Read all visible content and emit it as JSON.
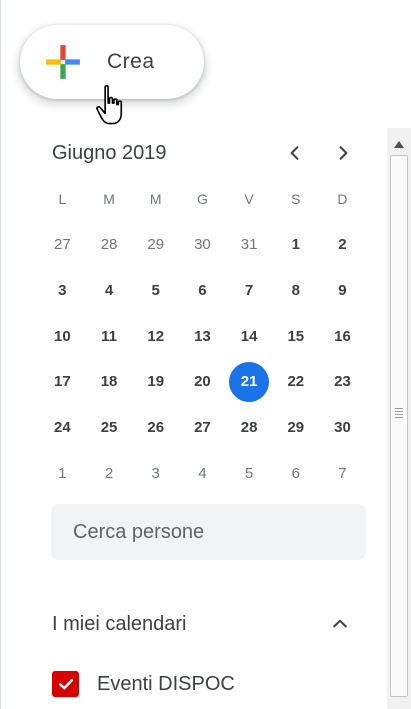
{
  "create_button": {
    "label": "Crea"
  },
  "mini_calendar": {
    "month_title": "Giugno 2019",
    "weekdays": [
      "L",
      "M",
      "M",
      "G",
      "V",
      "S",
      "D"
    ],
    "weeks": [
      [
        {
          "d": "27",
          "out": true
        },
        {
          "d": "28",
          "out": true
        },
        {
          "d": "29",
          "out": true
        },
        {
          "d": "30",
          "out": true
        },
        {
          "d": "31",
          "out": true
        },
        {
          "d": "1"
        },
        {
          "d": "2"
        }
      ],
      [
        {
          "d": "3"
        },
        {
          "d": "4"
        },
        {
          "d": "5"
        },
        {
          "d": "6"
        },
        {
          "d": "7"
        },
        {
          "d": "8"
        },
        {
          "d": "9"
        }
      ],
      [
        {
          "d": "10"
        },
        {
          "d": "11"
        },
        {
          "d": "12"
        },
        {
          "d": "13"
        },
        {
          "d": "14"
        },
        {
          "d": "15"
        },
        {
          "d": "16"
        }
      ],
      [
        {
          "d": "17"
        },
        {
          "d": "18"
        },
        {
          "d": "19"
        },
        {
          "d": "20"
        },
        {
          "d": "21",
          "today": true
        },
        {
          "d": "22"
        },
        {
          "d": "23"
        }
      ],
      [
        {
          "d": "24"
        },
        {
          "d": "25"
        },
        {
          "d": "26"
        },
        {
          "d": "27"
        },
        {
          "d": "28"
        },
        {
          "d": "29"
        },
        {
          "d": "30"
        }
      ],
      [
        {
          "d": "1",
          "out": true
        },
        {
          "d": "2",
          "out": true
        },
        {
          "d": "3",
          "out": true
        },
        {
          "d": "4",
          "out": true
        },
        {
          "d": "5",
          "out": true
        },
        {
          "d": "6",
          "out": true
        },
        {
          "d": "7",
          "out": true
        }
      ]
    ]
  },
  "search_people": {
    "placeholder": "Cerca persone"
  },
  "my_calendars": {
    "title": "I miei calendari",
    "items": [
      {
        "label": "Eventi DISPOC",
        "checked": true,
        "color": "#d50000"
      }
    ]
  },
  "colors": {
    "accent": "#1a73e8",
    "calendar_red": "#d50000",
    "plus_blue": "#4285f4",
    "plus_red": "#ea4335",
    "plus_yellow": "#fbbc04",
    "plus_green": "#34a853"
  }
}
